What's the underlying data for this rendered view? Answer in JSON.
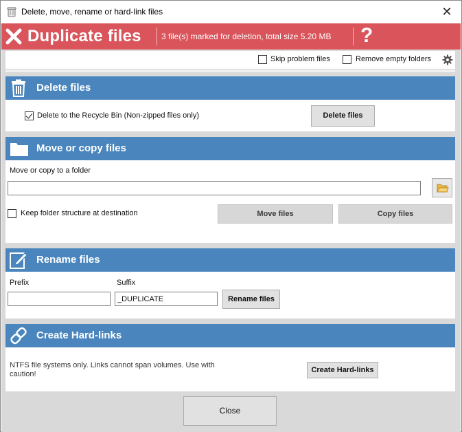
{
  "window": {
    "title": "Delete, move, rename or hard-link files",
    "close_glyph": "✕",
    "app_icon": "recycle-bin-icon"
  },
  "banner": {
    "title": "Duplicate files",
    "status": "3 file(s) marked for deletion, total size 5.20 MB",
    "help_glyph": "?",
    "icon": "x-icon",
    "color": "#d9545b"
  },
  "options": {
    "skip_problem_label": "Skip problem files",
    "skip_problem_checked": false,
    "remove_empty_label": "Remove empty folders",
    "remove_empty_checked": false,
    "settings_icon": "gear-icon"
  },
  "delete_section": {
    "title": "Delete files",
    "icon": "trash-icon",
    "recycle_label": "Delete to the Recycle Bin (Non-zipped files only)",
    "recycle_checked": true,
    "button": "Delete files"
  },
  "move_section": {
    "title": "Move or copy files",
    "icon": "folder-icon",
    "folder_label": "Move or copy to a folder",
    "folder_value": "",
    "keep_structure_label": "Keep folder structure at destination",
    "keep_structure_checked": false,
    "move_button": "Move files",
    "copy_button": "Copy files",
    "browse_icon": "open-folder-icon"
  },
  "rename_section": {
    "title": "Rename files",
    "icon": "edit-icon",
    "prefix_label": "Prefix",
    "prefix_value": "",
    "suffix_label": "Suffix",
    "suffix_value": "_DUPLICATE",
    "button": "Rename files"
  },
  "hardlink_section": {
    "title": "Create Hard-links",
    "icon": "link-icon",
    "note_line1": "NTFS file systems only.  Links cannot span volumes.  Use with",
    "note_line2": "caution!",
    "button": "Create Hard-links"
  },
  "footer": {
    "close_button": "Close"
  },
  "colors": {
    "section_header": "#4a86bd",
    "background": "#d9d9d9"
  }
}
